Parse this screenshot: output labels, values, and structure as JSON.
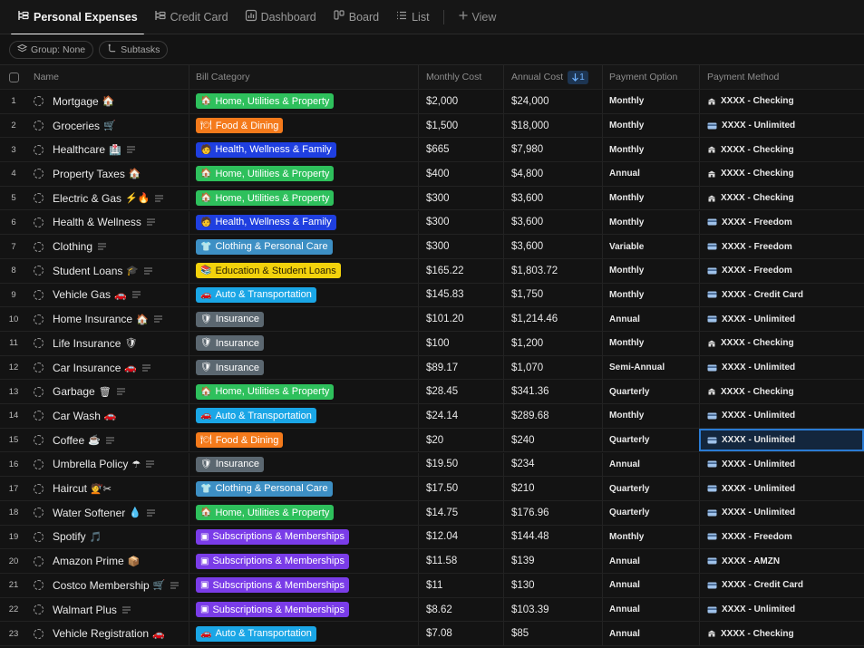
{
  "tabs": [
    {
      "label": "Personal Expenses",
      "icon": "list-tree-icon",
      "active": true
    },
    {
      "label": "Credit Card",
      "icon": "list-tree-icon",
      "active": false
    },
    {
      "label": "Dashboard",
      "icon": "dashboard-icon",
      "active": false
    },
    {
      "label": "Board",
      "icon": "board-icon",
      "active": false
    },
    {
      "label": "List",
      "icon": "list-icon",
      "active": false
    }
  ],
  "add_view_label": "View",
  "filters": {
    "group_label": "Group: None",
    "subtasks_label": "Subtasks"
  },
  "columns": {
    "name": "Name",
    "category": "Bill Category",
    "monthly": "Monthly Cost",
    "annual": "Annual Cost",
    "annual_sort": "1",
    "payment_option": "Payment Option",
    "payment_method": "Payment Method"
  },
  "category_colors": {
    "Home, Utilities & Property": "#2ec05c",
    "Food & Dining": "#f47a1b",
    "Health, Wellness & Family": "#1f3fe0",
    "Clothing & Personal Care": "#3d8fc4",
    "Education & Student Loans": "#f2d20c",
    "Auto & Transportation": "#1aa6e6",
    "Insurance": "#5b6770",
    "Subscriptions & Memberships": "#7a3ce8"
  },
  "category_emoji": {
    "Home, Utilities & Property": "🏠",
    "Food & Dining": "🍽",
    "Health, Wellness & Family": "🧑",
    "Clothing & Personal Care": "👕",
    "Education & Student Loans": "📚",
    "Auto & Transportation": "🚗",
    "Insurance": "🛡",
    "Subscriptions & Memberships": "▣"
  },
  "rows": [
    {
      "num": "1",
      "name": "Mortgage",
      "emoji": "🏠",
      "desc": false,
      "category": "Home, Utilities & Property",
      "monthly": "$2,000",
      "annual": "$24,000",
      "option": "Monthly",
      "method": "XXXX - Checking",
      "method_icon": "bank-icon"
    },
    {
      "num": "2",
      "name": "Groceries",
      "emoji": "🛒",
      "desc": false,
      "category": "Food & Dining",
      "monthly": "$1,500",
      "annual": "$18,000",
      "option": "Monthly",
      "method": "XXXX - Unlimited",
      "method_icon": "card-icon"
    },
    {
      "num": "3",
      "name": "Healthcare",
      "emoji": "🏥",
      "desc": true,
      "category": "Health, Wellness & Family",
      "monthly": "$665",
      "annual": "$7,980",
      "option": "Monthly",
      "method": "XXXX - Checking",
      "method_icon": "bank-icon"
    },
    {
      "num": "4",
      "name": "Property Taxes",
      "emoji": "🏠",
      "desc": false,
      "category": "Home, Utilities & Property",
      "monthly": "$400",
      "annual": "$4,800",
      "option": "Annual",
      "method": "XXXX - Checking",
      "method_icon": "bank-icon"
    },
    {
      "num": "5",
      "name": "Electric & Gas",
      "emoji": "⚡🔥",
      "desc": true,
      "category": "Home, Utilities & Property",
      "monthly": "$300",
      "annual": "$3,600",
      "option": "Monthly",
      "method": "XXXX - Checking",
      "method_icon": "bank-icon"
    },
    {
      "num": "6",
      "name": "Health & Wellness",
      "emoji": "",
      "desc": true,
      "category": "Health, Wellness & Family",
      "monthly": "$300",
      "annual": "$3,600",
      "option": "Monthly",
      "method": "XXXX - Freedom",
      "method_icon": "card-icon"
    },
    {
      "num": "7",
      "name": "Clothing",
      "emoji": "",
      "desc": true,
      "category": "Clothing & Personal Care",
      "monthly": "$300",
      "annual": "$3,600",
      "option": "Variable",
      "method": "XXXX - Freedom",
      "method_icon": "card-icon"
    },
    {
      "num": "8",
      "name": "Student Loans",
      "emoji": "🎓",
      "desc": true,
      "category": "Education & Student Loans",
      "monthly": "$165.22",
      "annual": "$1,803.72",
      "option": "Monthly",
      "method": "XXXX - Freedom",
      "method_icon": "card-icon"
    },
    {
      "num": "9",
      "name": "Vehicle Gas",
      "emoji": "🚗",
      "desc": true,
      "category": "Auto & Transportation",
      "monthly": "$145.83",
      "annual": "$1,750",
      "option": "Monthly",
      "method": "XXXX - Credit Card",
      "method_icon": "card-icon"
    },
    {
      "num": "10",
      "name": "Home Insurance",
      "emoji": "🏠",
      "desc": true,
      "category": "Insurance",
      "monthly": "$101.20",
      "annual": "$1,214.46",
      "option": "Annual",
      "method": "XXXX - Unlimited",
      "method_icon": "card-icon"
    },
    {
      "num": "11",
      "name": "Life Insurance",
      "emoji": "🛡",
      "desc": false,
      "category": "Insurance",
      "monthly": "$100",
      "annual": "$1,200",
      "option": "Monthly",
      "method": "XXXX - Checking",
      "method_icon": "bank-icon"
    },
    {
      "num": "12",
      "name": "Car Insurance",
      "emoji": "🚗",
      "desc": true,
      "category": "Insurance",
      "monthly": "$89.17",
      "annual": "$1,070",
      "option": "Semi-Annual",
      "method": "XXXX - Unlimited",
      "method_icon": "card-icon"
    },
    {
      "num": "13",
      "name": "Garbage",
      "emoji": "🗑",
      "desc": true,
      "category": "Home, Utilities & Property",
      "monthly": "$28.45",
      "annual": "$341.36",
      "option": "Quarterly",
      "method": "XXXX - Checking",
      "method_icon": "bank-icon"
    },
    {
      "num": "14",
      "name": "Car Wash",
      "emoji": "🚗",
      "desc": false,
      "category": "Auto & Transportation",
      "monthly": "$24.14",
      "annual": "$289.68",
      "option": "Monthly",
      "method": "XXXX - Unlimited",
      "method_icon": "card-icon"
    },
    {
      "num": "15",
      "name": "Coffee",
      "emoji": "☕",
      "desc": true,
      "category": "Food & Dining",
      "monthly": "$20",
      "annual": "$240",
      "option": "Quarterly",
      "method": "XXXX - Unlimited",
      "method_icon": "card-icon",
      "selected": true
    },
    {
      "num": "16",
      "name": "Umbrella Policy",
      "emoji": "☂",
      "desc": true,
      "category": "Insurance",
      "monthly": "$19.50",
      "annual": "$234",
      "option": "Annual",
      "method": "XXXX - Unlimited",
      "method_icon": "card-icon"
    },
    {
      "num": "17",
      "name": "Haircut",
      "emoji": "💇✂",
      "desc": false,
      "category": "Clothing & Personal Care",
      "monthly": "$17.50",
      "annual": "$210",
      "option": "Quarterly",
      "method": "XXXX - Unlimited",
      "method_icon": "card-icon"
    },
    {
      "num": "18",
      "name": "Water Softener",
      "emoji": "💧",
      "desc": true,
      "category": "Home, Utilities & Property",
      "monthly": "$14.75",
      "annual": "$176.96",
      "option": "Quarterly",
      "method": "XXXX - Unlimited",
      "method_icon": "card-icon"
    },
    {
      "num": "19",
      "name": "Spotify",
      "emoji": "🎵",
      "desc": false,
      "category": "Subscriptions & Memberships",
      "monthly": "$12.04",
      "annual": "$144.48",
      "option": "Monthly",
      "method": "XXXX - Freedom",
      "method_icon": "card-icon"
    },
    {
      "num": "20",
      "name": "Amazon Prime",
      "emoji": "📦",
      "desc": false,
      "category": "Subscriptions & Memberships",
      "monthly": "$11.58",
      "annual": "$139",
      "option": "Annual",
      "method": "XXXX - AMZN",
      "method_icon": "card-icon"
    },
    {
      "num": "21",
      "name": "Costco Membership",
      "emoji": "🛒",
      "desc": true,
      "category": "Subscriptions & Memberships",
      "monthly": "$11",
      "annual": "$130",
      "option": "Annual",
      "method": "XXXX - Credit Card",
      "method_icon": "card-icon"
    },
    {
      "num": "22",
      "name": "Walmart Plus",
      "emoji": "",
      "desc": true,
      "category": "Subscriptions & Memberships",
      "monthly": "$8.62",
      "annual": "$103.39",
      "option": "Annual",
      "method": "XXXX - Unlimited",
      "method_icon": "card-icon"
    },
    {
      "num": "23",
      "name": "Vehicle Registration",
      "emoji": "🚗",
      "desc": false,
      "category": "Auto & Transportation",
      "monthly": "$7.08",
      "annual": "$85",
      "option": "Annual",
      "method": "XXXX - Checking",
      "method_icon": "bank-icon"
    }
  ]
}
